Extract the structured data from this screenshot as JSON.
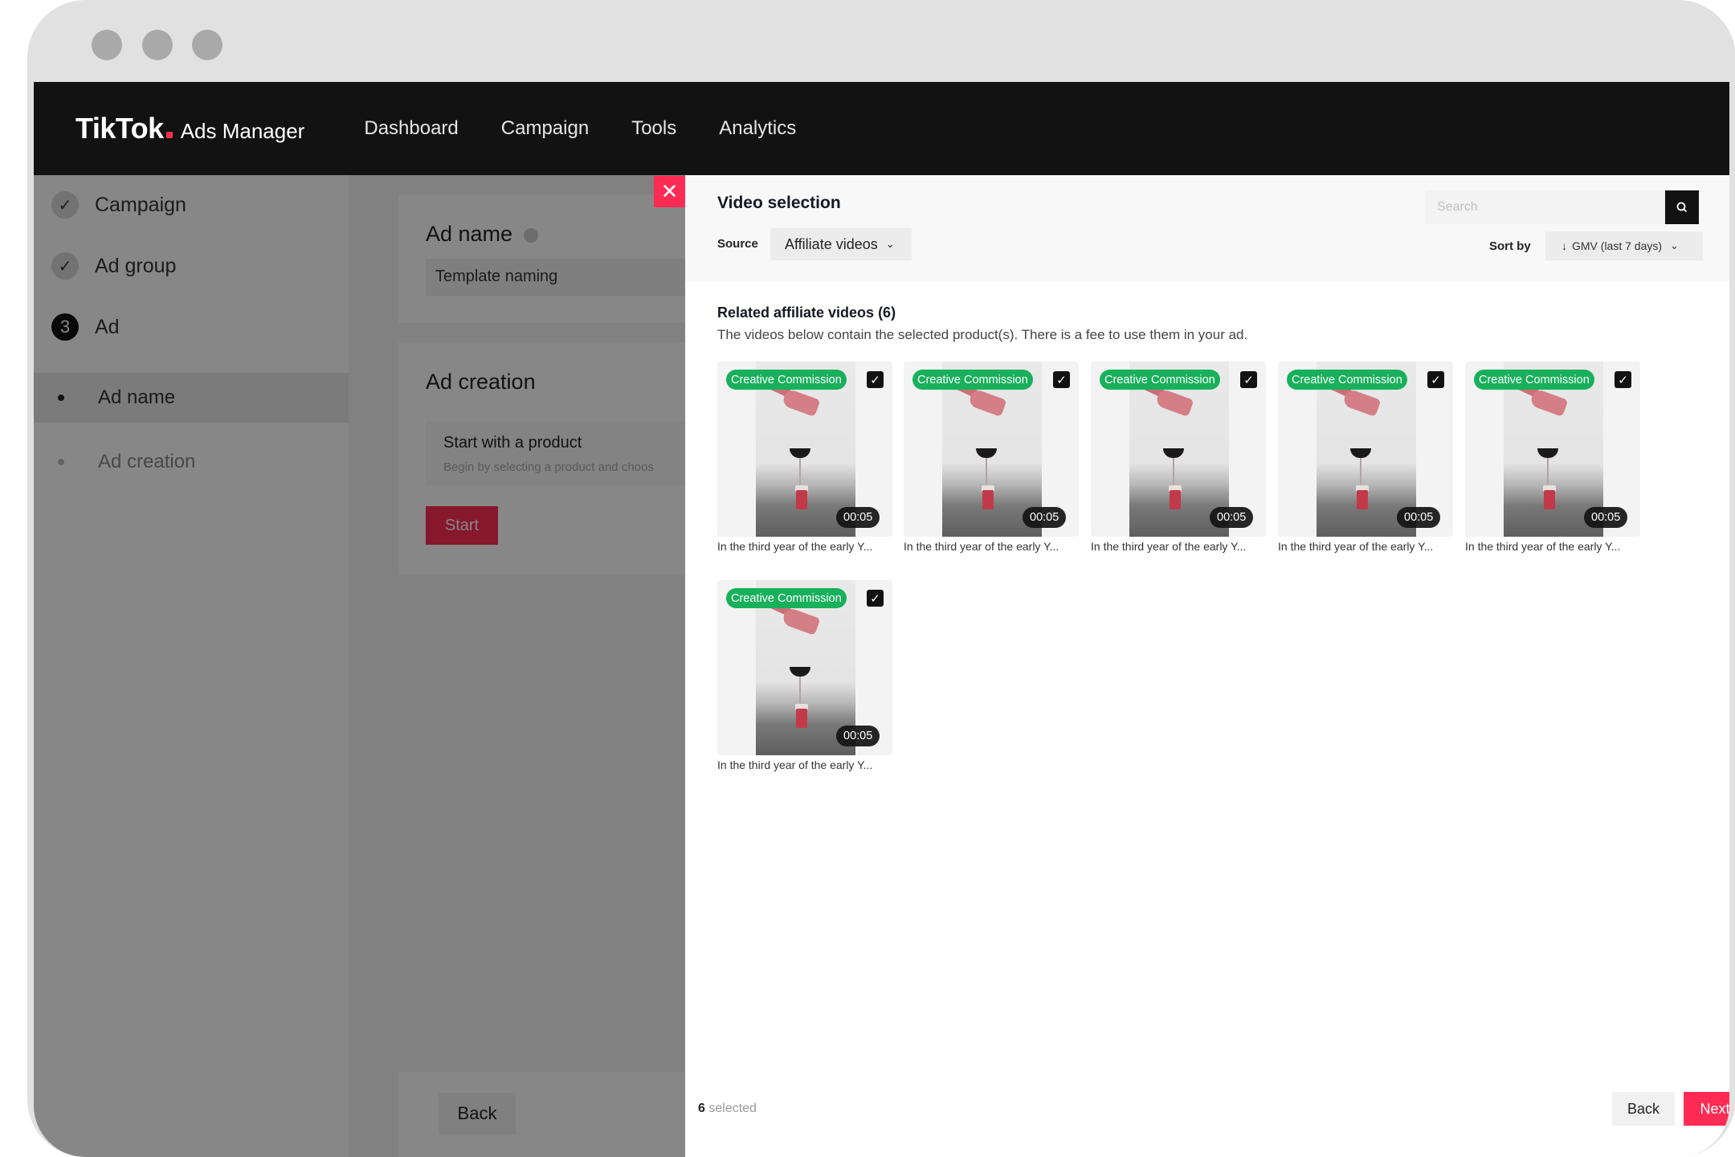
{
  "app": {
    "logo_main": "TikTok",
    "logo_sub": "Ads Manager",
    "nav": [
      "Dashboard",
      "Campaign",
      "Tools",
      "Analytics"
    ]
  },
  "sidebar": {
    "steps": [
      {
        "label": "Campaign",
        "status": "done",
        "icon": "check-icon"
      },
      {
        "label": "Ad group",
        "status": "done",
        "icon": "check-icon"
      },
      {
        "label": "Ad",
        "status": "current",
        "number": "3"
      }
    ],
    "substeps": [
      {
        "label": "Ad name",
        "active": true
      },
      {
        "label": "Ad creation",
        "active": false
      }
    ]
  },
  "background_form": {
    "ad_name_title": "Ad name",
    "ad_name_value": "Template naming",
    "ad_creation_title": "Ad creation",
    "start_title": "Start with a product",
    "start_desc": "Begin by selecting a product and choos",
    "start_button": "Start",
    "back_button": "Back"
  },
  "modal": {
    "title": "Video selection",
    "search_placeholder": "Search",
    "source_label": "Source",
    "source_value": "Affiliate videos",
    "sort_label": "Sort by",
    "sort_value": "GMV (last 7 days)",
    "related_title": "Related affiliate videos (6)",
    "related_desc": "The videos below contain the selected product(s). There is a fee to use them in your ad.",
    "videos": [
      {
        "badge": "Creative Commission",
        "duration": "00:05",
        "caption": "In the third year of the early Y...",
        "checked": true
      },
      {
        "badge": "Creative Commission",
        "duration": "00:05",
        "caption": "In the third year of the early Y...",
        "checked": true
      },
      {
        "badge": "Creative Commission",
        "duration": "00:05",
        "caption": "In the third year of the early Y...",
        "checked": true
      },
      {
        "badge": "Creative Commission",
        "duration": "00:05",
        "caption": "In the third year of the early Y...",
        "checked": true
      },
      {
        "badge": "Creative Commission",
        "duration": "00:05",
        "caption": "In the third year of the early Y...",
        "checked": true
      },
      {
        "badge": "Creative Commission",
        "duration": "00:05",
        "caption": "In the third year of the early Y...",
        "checked": true
      }
    ],
    "selected_count": "6",
    "selected_label": "selected",
    "back_button": "Back",
    "next_button": "Next"
  },
  "colors": {
    "brand_pink": "#fe2c55",
    "badge_green": "#18b05b",
    "nav_bg": "#121212"
  }
}
